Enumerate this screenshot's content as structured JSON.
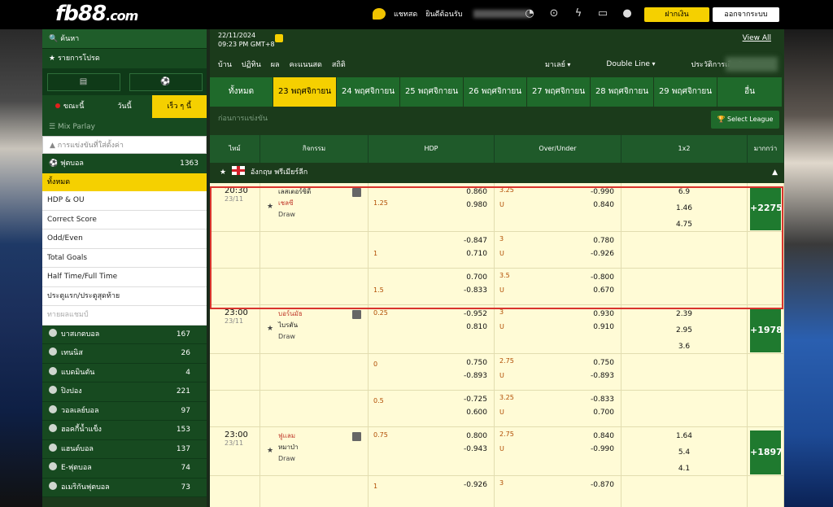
{
  "header": {
    "logo": "fb88",
    "logo_suffix": ".com",
    "chat_label": "แชทสด",
    "welcome_label": "ยินดีต้อนรับ",
    "deposit_label": "ฝากเงิน",
    "logout_label": "ออกจากระบบ",
    "accent": "#f5d000"
  },
  "sidebar": {
    "search_label": "ค้นหา",
    "promo_label": "รายการโปรด",
    "tabs": [
      "ขณะนี้",
      "วันนี้",
      "เร็ว ๆ นี้"
    ],
    "mix_parlay": "Mix Parlay",
    "notif_label": "การแข่งขันที่ใส่ตั้งค่า",
    "football": {
      "label": "ฟุตบอล",
      "count": "1363"
    },
    "all_label": "ทั้งหมด",
    "markets": [
      "HDP & OU",
      "Correct Score",
      "Odd/Even",
      "Total Goals",
      "Half Time/Full Time",
      "ประตูแรก/ประตูสุดท้าย",
      "ทายผลแชมป์"
    ],
    "sports": [
      {
        "label": "บาสเกตบอล",
        "count": "167"
      },
      {
        "label": "เทนนิส",
        "count": "26"
      },
      {
        "label": "แบดมินตัน",
        "count": "4"
      },
      {
        "label": "ปิงปอง",
        "count": "221"
      },
      {
        "label": "วอลเลย์บอล",
        "count": "97"
      },
      {
        "label": "ฮอคกี้น้ำแข็ง",
        "count": "153"
      },
      {
        "label": "แฮนด์บอล",
        "count": "137"
      },
      {
        "label": "E-ฟุตบอล",
        "count": "74"
      },
      {
        "label": "อเมริกันฟุตบอล",
        "count": "73"
      }
    ]
  },
  "main": {
    "date": "22/11/2024",
    "time": "09:23 PM GMT+8",
    "view_all": "View All",
    "nav": [
      "บ้าน",
      "ปฏิทิน",
      "ผล",
      "คะแนนสด",
      "สถิติ"
    ],
    "nav_right": [
      "มาเลย์",
      "Double Line",
      "ประวัติการเดิมพัน"
    ],
    "date_tabs": [
      "ทั้งหมด",
      "23 พฤศจิกายน",
      "24 พฤศจิกายน",
      "25 พฤศจิกายน",
      "26 พฤศจิกายน",
      "27 พฤศจิกายน",
      "28 พฤศจิกายน",
      "29 พฤศจิกายน",
      "อื่น"
    ],
    "prematch_label": "ก่อนการแข่งขัน",
    "select_league": "Select League",
    "columns": [
      "ไทม์",
      "กิจกรรม",
      "HDP",
      "Over/Under",
      "1x2",
      "มากกว่า"
    ],
    "league": "อังกฤษ พรีเมียร์ลีก"
  },
  "matches": [
    {
      "time": "20:30",
      "date": "23/11",
      "home": "เลสเตอร์ซิตี้",
      "away": "เชลซี",
      "draw": "Draw",
      "x12": [
        "6.9",
        "1.46",
        "4.75"
      ],
      "more": "+2275",
      "lines": [
        {
          "hdp": "1.25",
          "hdp_h": "0.860",
          "hdp_a": "0.980",
          "ou": "3.25",
          "ou_u": "U",
          "ou_o": "-0.990",
          "ou_uo": "0.840"
        },
        {
          "hdp": "1",
          "hdp_h": "-0.847",
          "hdp_a": "0.710",
          "ou": "3",
          "ou_u": "U",
          "ou_o": "0.780",
          "ou_uo": "-0.926"
        },
        {
          "hdp": "1.5",
          "hdp_h": "0.700",
          "hdp_a": "-0.833",
          "ou": "3.5",
          "ou_u": "U",
          "ou_o": "-0.800",
          "ou_uo": "0.670"
        }
      ]
    },
    {
      "time": "23:00",
      "date": "23/11",
      "home": "บอร์นมัธ",
      "away": "ไบรตัน",
      "draw": "Draw",
      "x12": [
        "2.39",
        "2.95",
        "3.6"
      ],
      "more": "+1978",
      "lines": [
        {
          "hdp": "0.25",
          "hdp_h": "-0.952",
          "hdp_a": "0.810",
          "ou": "3",
          "ou_u": "U",
          "ou_o": "0.930",
          "ou_uo": "0.910"
        },
        {
          "hdp": "0",
          "hdp_h": "0.750",
          "hdp_a": "-0.893",
          "ou": "2.75",
          "ou_u": "U",
          "ou_o": "0.750",
          "ou_uo": "-0.893"
        },
        {
          "hdp": "0.5",
          "hdp_h": "-0.725",
          "hdp_a": "0.600",
          "ou": "3.25",
          "ou_u": "U",
          "ou_o": "-0.833",
          "ou_uo": "0.700"
        }
      ]
    },
    {
      "time": "23:00",
      "date": "23/11",
      "home": "ฟูแลม",
      "away": "หมาป่า",
      "draw": "Draw",
      "x12": [
        "1.64",
        "5.4",
        "4.1"
      ],
      "more": "+1897",
      "lines": [
        {
          "hdp": "0.75",
          "hdp_h": "0.800",
          "hdp_a": "-0.943",
          "ou": "2.75",
          "ou_u": "U",
          "ou_o": "0.840",
          "ou_uo": "-0.990"
        },
        {
          "hdp": "1",
          "hdp_h": "-0.926",
          "hdp_a": "",
          "ou": "3",
          "ou_u": "",
          "ou_o": "-0.870",
          "ou_uo": ""
        }
      ]
    }
  ]
}
